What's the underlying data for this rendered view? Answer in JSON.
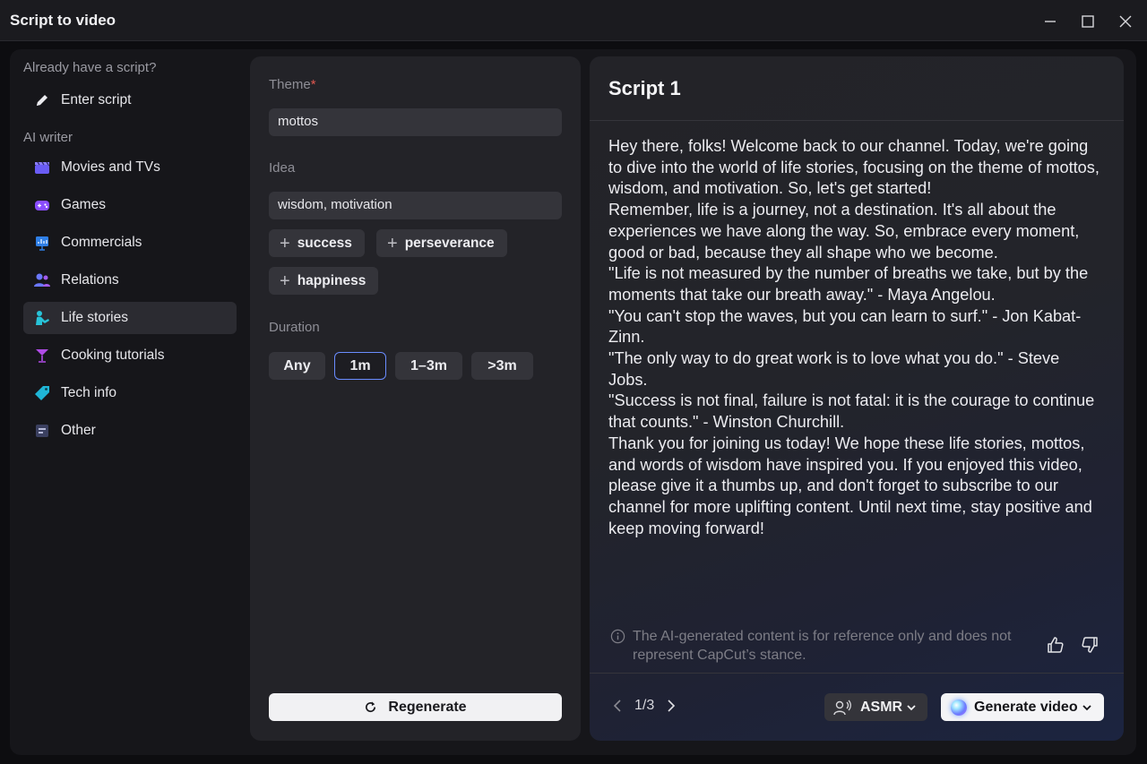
{
  "window": {
    "title": "Script to video"
  },
  "sidebar": {
    "section_script": "Already have a script?",
    "enter_script": "Enter script",
    "section_ai": "AI writer",
    "items": [
      {
        "label": "Movies and TVs",
        "icon": "clapperboard-icon"
      },
      {
        "label": "Games",
        "icon": "gamepad-icon"
      },
      {
        "label": "Commercials",
        "icon": "presentation-chart-icon"
      },
      {
        "label": "Relations",
        "icon": "people-icon"
      },
      {
        "label": "Life stories",
        "icon": "person-reading-icon",
        "active": true
      },
      {
        "label": "Cooking tutorials",
        "icon": "cocktail-glass-icon"
      },
      {
        "label": "Tech info",
        "icon": "tag-icon"
      },
      {
        "label": "Other",
        "icon": "document-lines-icon"
      }
    ]
  },
  "form": {
    "theme_label": "Theme",
    "required_mark": "*",
    "theme_value": "mottos",
    "idea_label": "Idea",
    "idea_value": "wisdom, motivation",
    "suggestions": [
      "success",
      "perseverance",
      "happiness"
    ],
    "duration_label": "Duration",
    "durations": [
      "Any",
      "1m",
      "1–3m",
      ">3m"
    ],
    "selected_duration": "1m",
    "regenerate_label": "Regenerate"
  },
  "script": {
    "title": "Script 1",
    "paragraphs": [
      "Hey there, folks! Welcome back to our channel. Today, we're going to dive into the world of life stories, focusing on the theme of mottos, wisdom, and motivation. So, let's get started!",
      "Remember, life is a journey, not a destination. It's all about the experiences we have along the way. So, embrace every moment, good or bad, because they all shape who we become.",
      "\"Life is not measured by the number of breaths we take, but by the moments that take our breath away.\" - Maya Angelou.",
      "\"You can't stop the waves, but you can learn to surf.\" - Jon Kabat-Zinn.",
      "\"The only way to do great work is to love what you do.\" - Steve Jobs.",
      "\"Success is not final, failure is not fatal: it is the courage to continue that counts.\" - Winston Churchill.",
      "Thank you for joining us today! We hope these life stories, mottos, and words of wisdom have inspired you. If you enjoyed this video, please give it a thumbs up, and don't forget to subscribe to our channel for more uplifting content. Until next time, stay positive and keep moving forward!"
    ],
    "disclaimer": "The AI-generated content is for reference only and does not represent CapCut’s stance.",
    "page_indicator": "1/3",
    "voice_label": "ASMR",
    "generate_label": "Generate video"
  },
  "colors": {
    "accent_selected_border": "#6a8cff",
    "required": "#e0574f"
  }
}
